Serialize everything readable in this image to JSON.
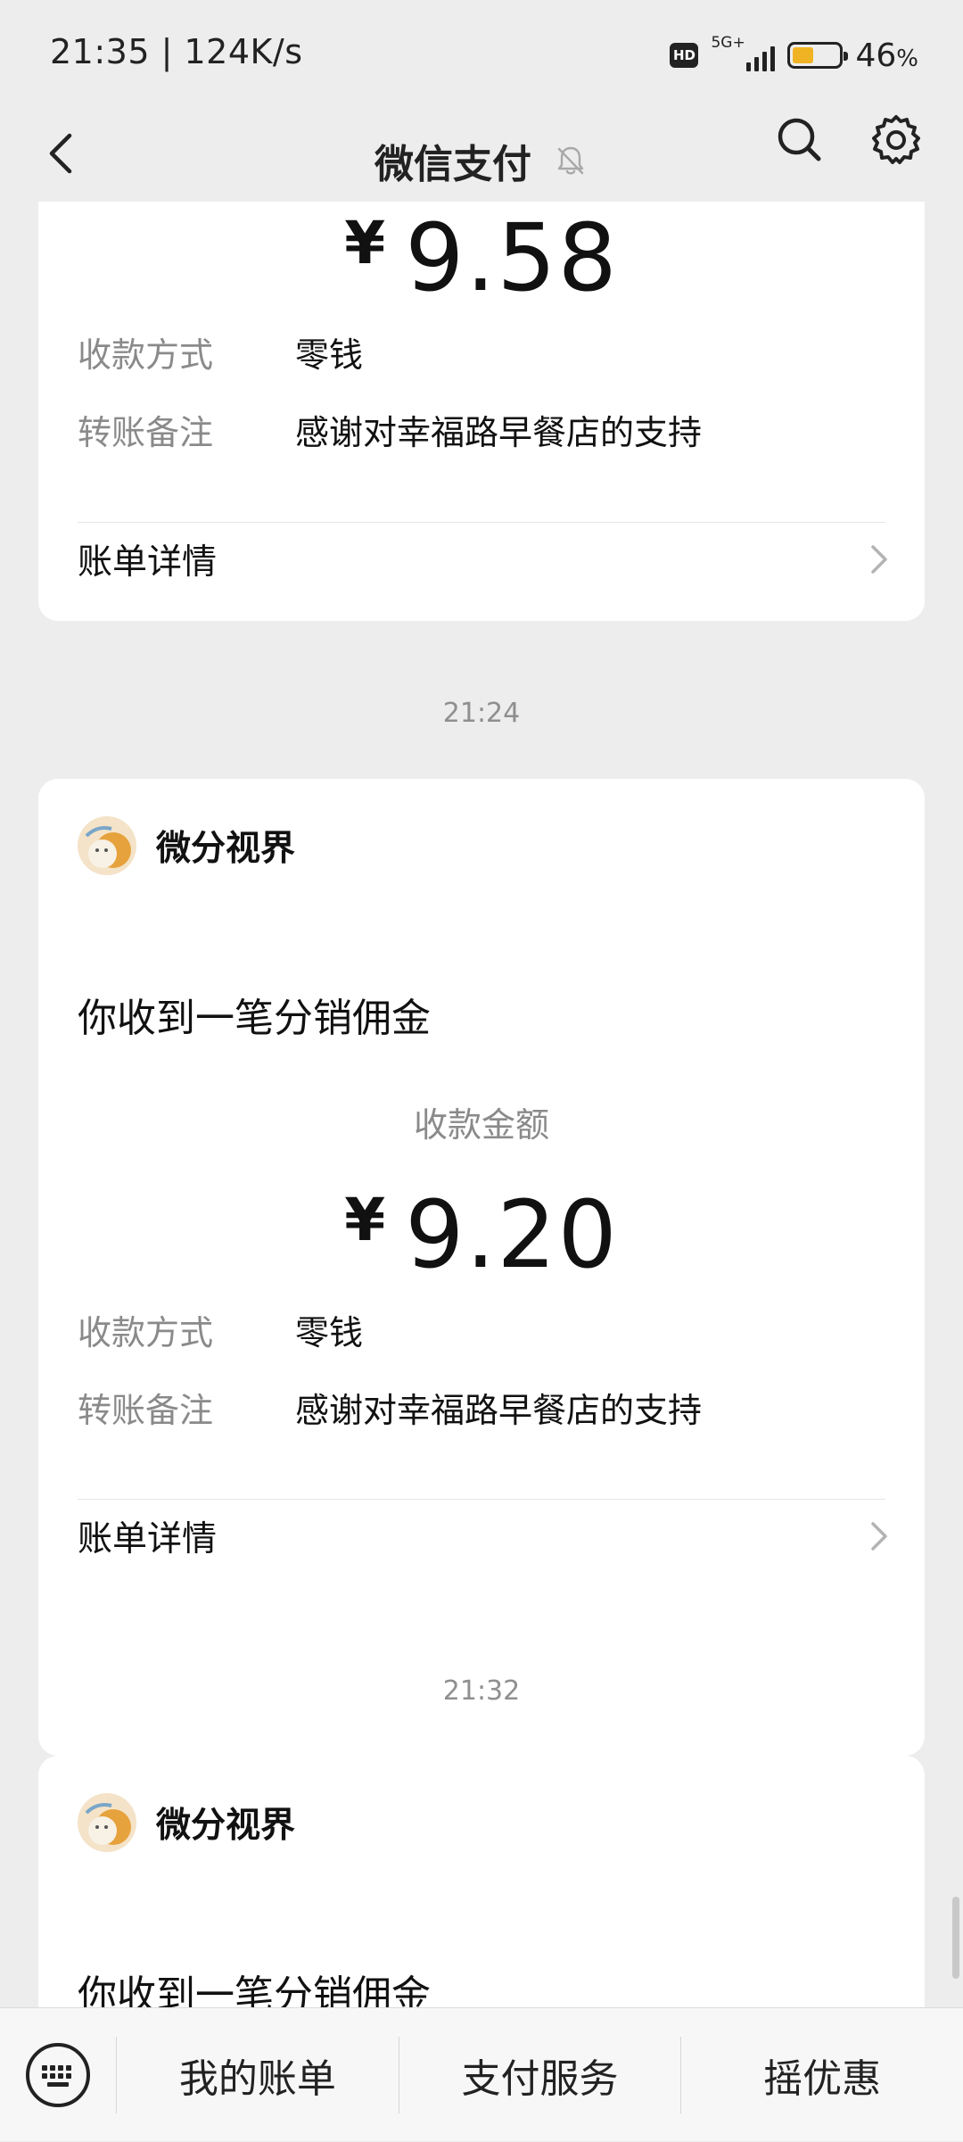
{
  "status_bar": {
    "time_speed": "21:35 | 124K/s",
    "hd_badge": "HD",
    "network": "5G+",
    "battery_level": 0.46,
    "battery_percent": "46",
    "battery_unit": "%"
  },
  "nav": {
    "title": "微信支付",
    "back_icon": "back-arrow-icon",
    "mute_icon": "bell-off-icon",
    "search_icon": "search-icon",
    "settings_icon": "gear-icon"
  },
  "messages": [
    {
      "amount_yen": "¥",
      "amount": "9.58",
      "method_label": "收款方式",
      "method_value": "零钱",
      "note_label": "转账备注",
      "note_value": "感谢对幸福路早餐店的支持",
      "detail_label": "账单详情"
    },
    {
      "time": "21:24",
      "merchant": "微分视界",
      "title": "你收到一笔分销佣金",
      "amount_caption": "收款金额",
      "amount_yen": "¥",
      "amount": "9.20",
      "method_label": "收款方式",
      "method_value": "零钱",
      "note_label": "转账备注",
      "note_value": "感谢对幸福路早餐店的支持",
      "detail_label": "账单详情"
    },
    {
      "time": "21:32",
      "merchant": "微分视界",
      "title": "你收到一笔分销佣金"
    }
  ],
  "bottom_bar": {
    "keyboard_icon": "keyboard-icon",
    "tabs": [
      "我的账单",
      "支付服务",
      "摇优惠"
    ]
  },
  "colors": {
    "background": "#ededed",
    "card": "#ffffff",
    "label_gray": "#8a8a8a",
    "battery_fill": "#f0b323"
  }
}
